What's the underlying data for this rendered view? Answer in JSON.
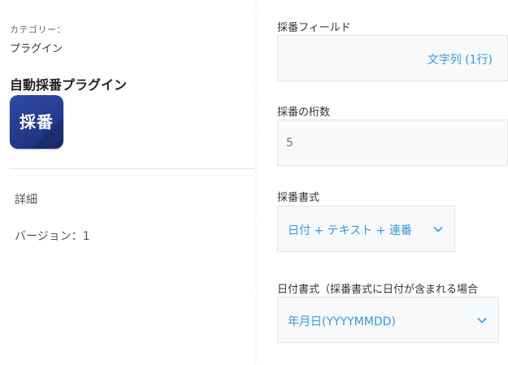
{
  "sidebar": {
    "category_label": "カテゴリー：",
    "category_value": "プラグイン",
    "plugin_name": "自動採番プラグイン",
    "plugin_icon_text": "採番",
    "detail_link": "詳細",
    "version": "バージョン：1"
  },
  "settings": {
    "numbering_field": {
      "label": "採番フィールド",
      "value": "文字列 (1行)"
    },
    "digits": {
      "label": "採番の桁数",
      "placeholder": "5"
    },
    "numbering_format": {
      "label": "採番書式",
      "selected": "日付 + テキスト + 連番"
    },
    "date_format": {
      "label": "日付書式（採番書式に日付が含まれる場合",
      "selected": "年月日(YYYYMMDD)"
    }
  },
  "colors": {
    "accent": "#3498db",
    "icon_bg": "#243a8c",
    "field_bg": "#f7f9fa"
  },
  "icons": {
    "select_arrow": "chevron-down-icon"
  }
}
